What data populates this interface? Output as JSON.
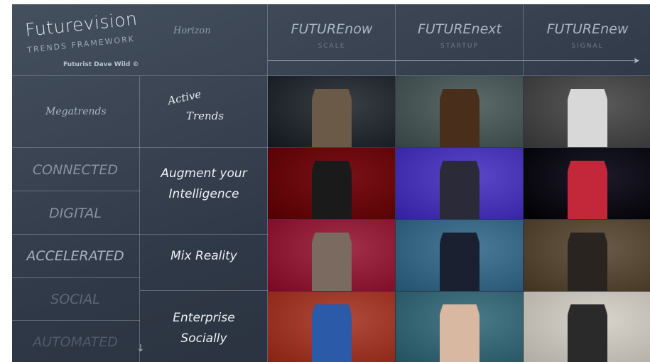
{
  "brand": {
    "title": "Futurevision",
    "subtitle": "TRENDS FRAMEWORK",
    "credit": "Futurist Dave Wild ©"
  },
  "horizon_label": "Horizon",
  "columns": [
    {
      "title": "FUTUREnow",
      "subtitle": "SCALE"
    },
    {
      "title": "FUTUREnext",
      "subtitle": "STARTUP"
    },
    {
      "title": "FUTUREnew",
      "subtitle": "SIGNAL"
    }
  ],
  "megatrends_label": "Megatrends",
  "active_trends_label": {
    "line1": "Active",
    "line2": "Trends"
  },
  "megatrends": [
    {
      "label": "CONNECTED",
      "color": "#8793a2"
    },
    {
      "label": "DIGITAL",
      "color": "#8793a2"
    },
    {
      "label": "ACCELERATED",
      "color": "#a8b3c0"
    },
    {
      "label": "SOCIAL",
      "color": "#5c6878"
    },
    {
      "label": "AUTOMATED",
      "color": "#4f5b6a"
    }
  ],
  "active_trends": [
    {
      "line1": "Augment your",
      "line2": "Intelligence"
    },
    {
      "line1": "Mix Reality",
      "line2": ""
    },
    {
      "line1": "Enterprise",
      "line2": "Socially"
    }
  ],
  "photos": [
    {
      "name": "photo-man-glasses-dark",
      "bg": "#3a3f45",
      "accent": "#6b5a48"
    },
    {
      "name": "photo-woman-curly-hair",
      "bg": "#5d6a6a",
      "accent": "#4a2e1c"
    },
    {
      "name": "photo-scientist-bw",
      "bg": "#5a5a5a",
      "accent": "#d8d8d8"
    },
    {
      "name": "photo-woman-red-stage",
      "bg": "#7a1018",
      "accent": "#1a1a1a"
    },
    {
      "name": "photo-man-purple-circuit",
      "bg": "#5a48c8",
      "accent": "#2a2a38"
    },
    {
      "name": "photo-woman-stage-code",
      "bg": "#1d1a2a",
      "accent": "#c2283a"
    },
    {
      "name": "photo-man-smiling-red",
      "bg": "#a2304a",
      "accent": "#7a6a60"
    },
    {
      "name": "photo-woman-blue-architecture",
      "bg": "#4a7a98",
      "accent": "#1a2030"
    },
    {
      "name": "photo-men-workshop",
      "bg": "#6a5a48",
      "accent": "#2a2420"
    },
    {
      "name": "photo-woman-holding-package",
      "bg": "#b04a3a",
      "accent": "#2a5aa8"
    },
    {
      "name": "photo-man-bald-smiling",
      "bg": "#4a7a88",
      "accent": "#d8b8a0"
    },
    {
      "name": "photo-man-bright-room",
      "bg": "#d8d4cc",
      "accent": "#2a2a2a"
    }
  ]
}
